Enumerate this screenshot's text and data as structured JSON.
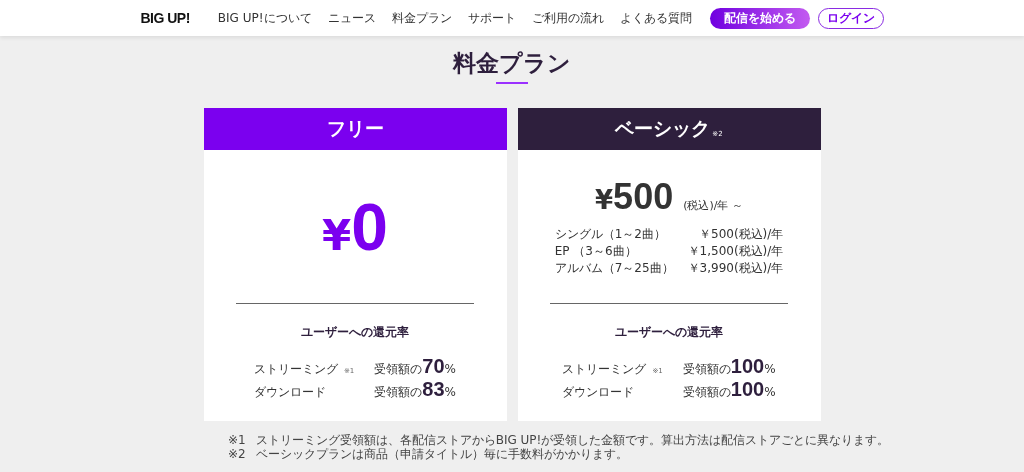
{
  "header": {
    "logo": "BIG UP!",
    "nav": [
      "BIG UP!について",
      "ニュース",
      "料金プラン",
      "サポート",
      "ご利用の流れ",
      "よくある質問"
    ],
    "cta": "配信を始める",
    "login": "ログイン"
  },
  "title": "料金プラン",
  "plans": [
    {
      "name": "フリー",
      "color": "#7b00ef",
      "currency": "¥",
      "price": "0",
      "rate_title": "ユーザーへの還元率",
      "rates": [
        {
          "label": "ストリーミング",
          "note": "※1",
          "prefix": "受領額の",
          "value": "70",
          "unit": "%"
        },
        {
          "label": "ダウンロード",
          "prefix": "受領額の",
          "value": "83",
          "unit": "%"
        }
      ]
    },
    {
      "name": "ベーシック",
      "note": "※2",
      "color": "#2e1f3d",
      "currency": "¥",
      "price": "500",
      "suffix": "(税込)/年 ～",
      "items": [
        {
          "label": "シングル（1～2曲）",
          "price": "￥500(税込)/年"
        },
        {
          "label": "EP （3～6曲）",
          "price": "￥1,500(税込)/年"
        },
        {
          "label": "アルバム（7～25曲）",
          "price": "￥3,990(税込)/年"
        }
      ],
      "rate_title": "ユーザーへの還元率",
      "rates": [
        {
          "label": "ストリーミング",
          "note": "※1",
          "prefix": "受領額の",
          "value": "100",
          "unit": "%"
        },
        {
          "label": "ダウンロード",
          "prefix": "受領額の",
          "value": "100",
          "unit": "%"
        }
      ]
    }
  ],
  "footnotes": [
    {
      "mark": "※1",
      "text": "ストリーミング受領額は、各配信ストアからBIG UP!が受領した金額です。算出方法は配信ストアごとに異なります。"
    },
    {
      "mark": "※2",
      "text": "ベーシックプランは商品（申請タイトル）毎に手数料がかかります。"
    }
  ]
}
